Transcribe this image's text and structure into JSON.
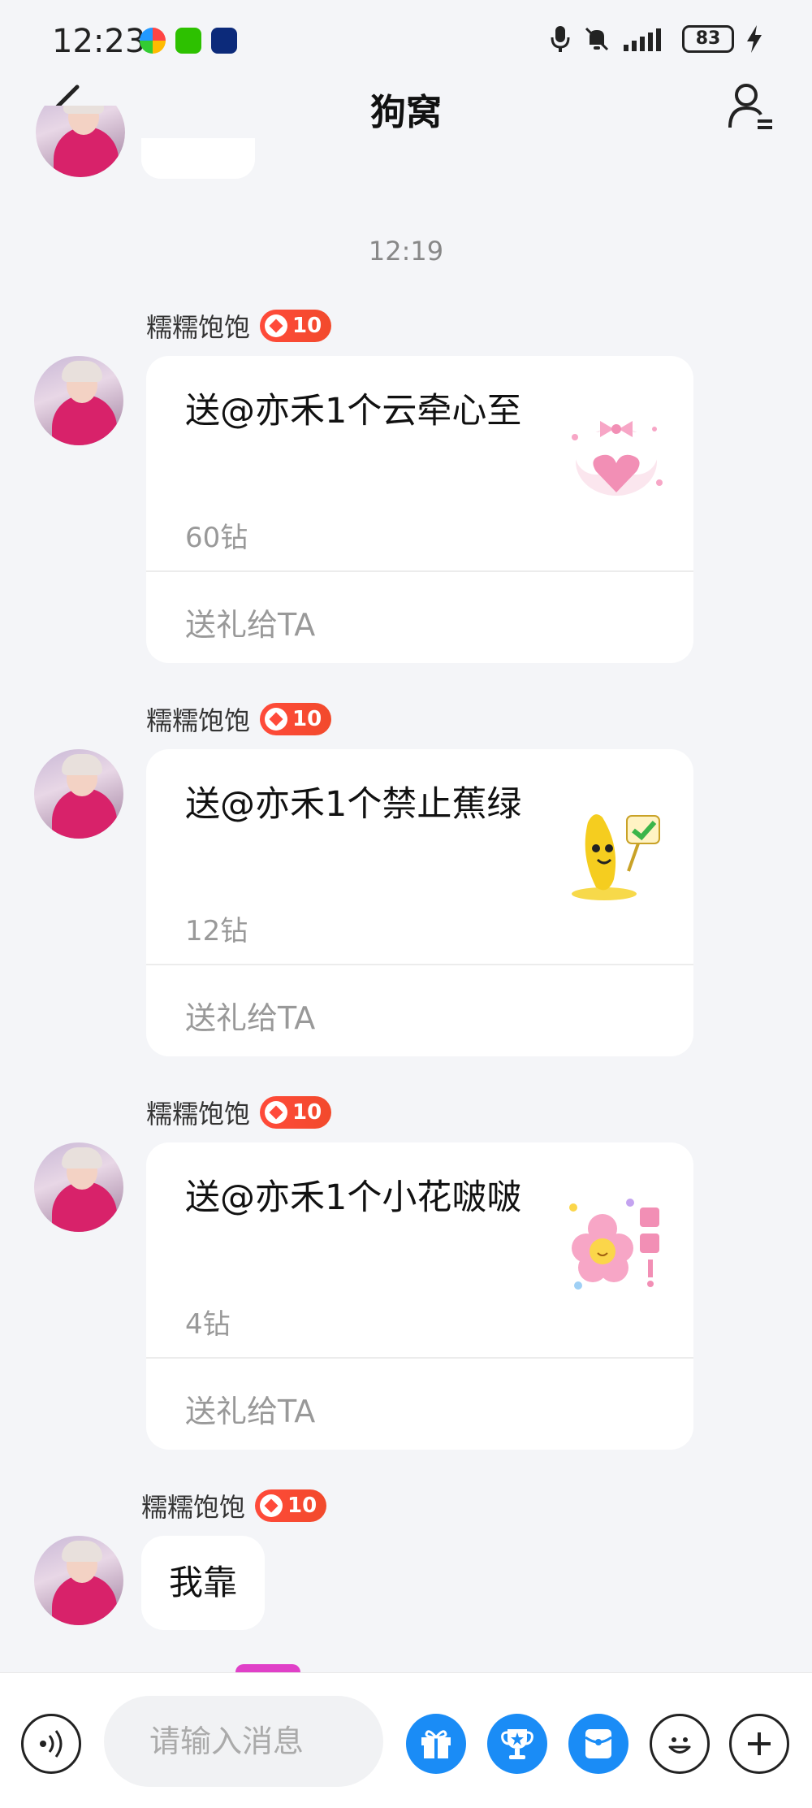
{
  "status_bar": {
    "time": "12:23",
    "battery": "83"
  },
  "header": {
    "title": "狗窝"
  },
  "chat": {
    "timestamp": "12:19",
    "messages": [
      {
        "sender": "糯糯饱饱",
        "level": "10",
        "type": "gift",
        "text": "送@亦禾1个云牵心至",
        "price": "60钻",
        "action": "送礼给TA",
        "gift_icon": "cloud-heart-icon"
      },
      {
        "sender": "糯糯饱饱",
        "level": "10",
        "type": "gift",
        "text": "送@亦禾1个禁止蕉绿",
        "price": "12钻",
        "action": "送礼给TA",
        "gift_icon": "banana-icon"
      },
      {
        "sender": "糯糯饱饱",
        "level": "10",
        "type": "gift",
        "text": "送@亦禾1个小花啵啵",
        "price": "4钻",
        "action": "送礼给TA",
        "gift_icon": "flower-icon"
      },
      {
        "sender": "糯糯饱饱",
        "level": "10",
        "type": "text",
        "text": "我靠"
      }
    ]
  },
  "input": {
    "placeholder": "请输入消息"
  },
  "colors": {
    "accent": "#1a8cf6",
    "level_badge": "#ff4a3a",
    "background": "#f4f5f8"
  }
}
